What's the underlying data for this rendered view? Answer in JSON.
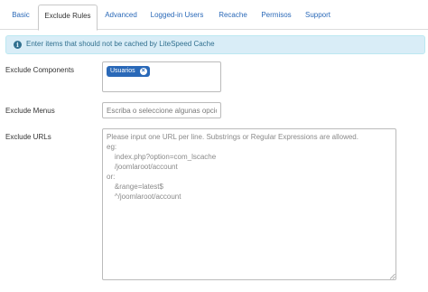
{
  "tabs": [
    {
      "label": "Basic",
      "active": false
    },
    {
      "label": "Exclude Rules",
      "active": true
    },
    {
      "label": "Advanced",
      "active": false
    },
    {
      "label": "Logged-in Users",
      "active": false
    },
    {
      "label": "Recache",
      "active": false
    },
    {
      "label": "Permisos",
      "active": false
    },
    {
      "label": "Support",
      "active": false
    }
  ],
  "alert": {
    "icon": "info-icon",
    "icon_glyph": "i",
    "text": "Enter items that should not be cached by LiteSpeed Cache"
  },
  "fields": {
    "components": {
      "label": "Exclude Components",
      "selected": [
        {
          "label": "Usuarios",
          "remove_glyph": "×"
        }
      ]
    },
    "menus": {
      "label": "Exclude Menus",
      "placeholder": "Escriba o seleccione algunas opciones",
      "value": ""
    },
    "urls": {
      "label": "Exclude URLs",
      "placeholder": "Please input one URL per line. Substrings or Regular Expressions are allowed.\neg:\n    index.php?option=com_lscache\n    /joomlaroot/account\nor:\n    &range=latest$\n    ^/joomlaroot/account",
      "value": ""
    }
  },
  "colors": {
    "link": "#2a69b8",
    "alert_bg": "#d9edf7",
    "alert_text": "#31708f",
    "chip_bg": "#2a69b8"
  }
}
